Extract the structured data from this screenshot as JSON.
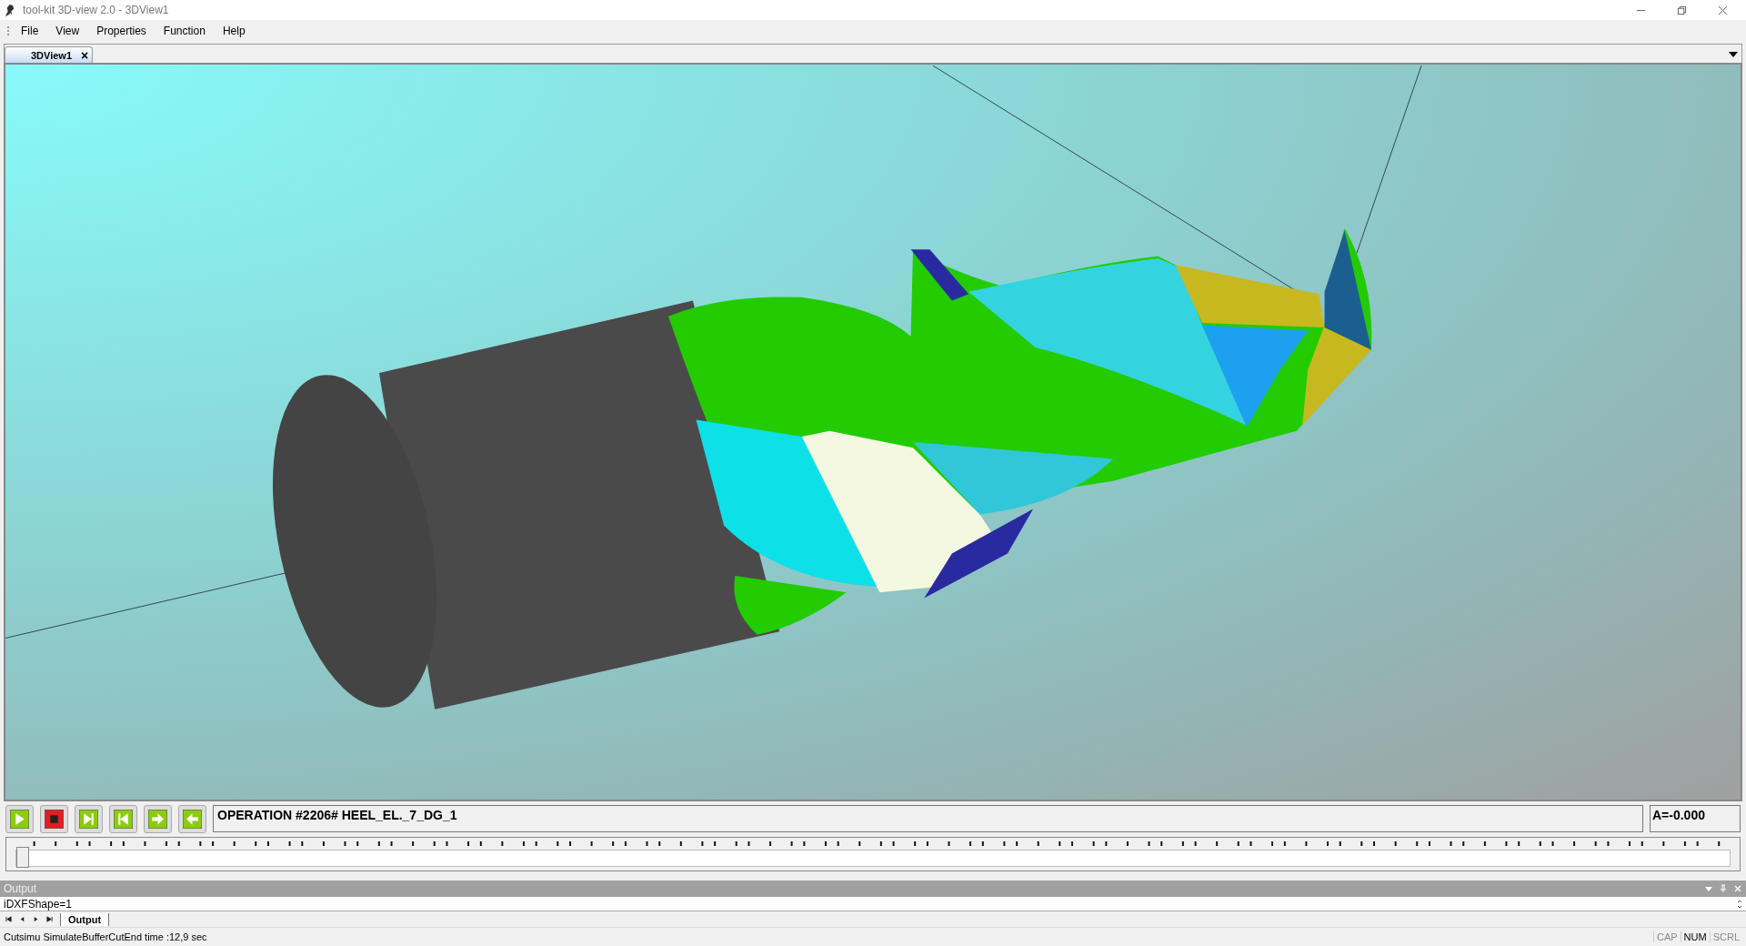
{
  "window": {
    "title": "tool-kit 3D-view 2.0 - 3DView1"
  },
  "menu": [
    "File",
    "View",
    "Properties",
    "Function",
    "Help"
  ],
  "tabs": [
    {
      "label": "3DView1",
      "selected": true,
      "close": "×"
    }
  ],
  "controls": {
    "buttons": [
      {
        "kind": "play"
      },
      {
        "kind": "stop"
      },
      {
        "kind": "step-forward"
      },
      {
        "kind": "step-back"
      },
      {
        "kind": "forward"
      },
      {
        "kind": "back"
      }
    ],
    "operation": "OPERATION #2206# HEEL_EL._7_DG_1",
    "angle": "A=-0.000",
    "slider": {
      "level": 0
    }
  },
  "output_panel": {
    "title": "Output",
    "lines": [
      "iDXFShape=1"
    ],
    "tabs": [
      {
        "label": "Output",
        "selected": true
      }
    ]
  },
  "status_bar": {
    "message": "Cutsimu SimulateBufferCutEnd time :12,9 sec",
    "indicators": [
      {
        "text": "CAP",
        "on": false
      },
      {
        "text": "NUM",
        "on": true
      },
      {
        "text": "SCRL",
        "on": false
      }
    ]
  }
}
